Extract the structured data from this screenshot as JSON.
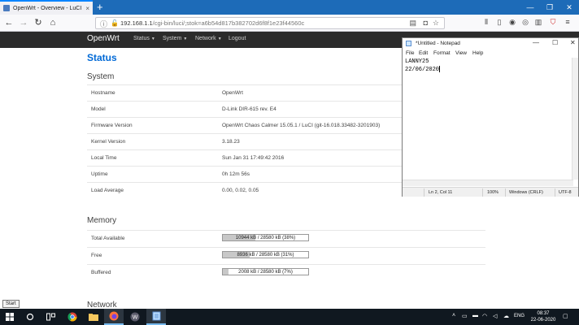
{
  "browser": {
    "tab_title": "OpenWrt - Overview - LuCI",
    "tab_close": "×",
    "new_tab": "+",
    "window_controls": [
      "—",
      "❐",
      "✕"
    ],
    "url_host": "192.168.1.1",
    "url_path": "/cgi-bin/luci/;stok=a6b54d817b382702d6f8f1e23f44560c",
    "icons": [
      "back-icon",
      "forward-icon",
      "reload-icon",
      "home-icon",
      "lock-warning-icon",
      "reader-icon",
      "pocket-icon",
      "star-icon",
      "library-icon",
      "sidebar-icon",
      "account-icon",
      "extension-icon",
      "menu-icon"
    ]
  },
  "header": {
    "brand": "OpenWrt",
    "menus": [
      "Status",
      "System",
      "Network",
      "Logout"
    ]
  },
  "page": {
    "title": "Status",
    "system": {
      "heading": "System",
      "rows": [
        {
          "label": "Hostname",
          "value": "OpenWrt"
        },
        {
          "label": "Model",
          "value": "D-Link DIR-615 rev. E4"
        },
        {
          "label": "Firmware Version",
          "value": "OpenWrt Chaos Calmer 15.05.1 / LuCI (git-16.018.33482-3201903)"
        },
        {
          "label": "Kernel Version",
          "value": "3.18.23"
        },
        {
          "label": "Local Time",
          "value": "Sun Jan 31 17:49:42 2016"
        },
        {
          "label": "Uptime",
          "value": "0h 12m 56s"
        },
        {
          "label": "Load Average",
          "value": "0.00, 0.02, 0.05"
        }
      ]
    },
    "memory": {
      "heading": "Memory",
      "rows": [
        {
          "label": "Total Available",
          "text": "10944 kB / 28580 kB (38%)",
          "percent": 38
        },
        {
          "label": "Free",
          "text": "8936 kB / 28580 kB (31%)",
          "percent": 31
        },
        {
          "label": "Buffered",
          "text": "2008 kB / 28580 kB (7%)",
          "percent": 7
        }
      ]
    },
    "network": {
      "heading": "Network"
    }
  },
  "notepad": {
    "title": "*Untitled - Notepad",
    "menu": [
      "File",
      "Edit",
      "Format",
      "View",
      "Help"
    ],
    "lines": [
      "LANNY25",
      "22/06/2020"
    ],
    "status": {
      "position": "Ln 2, Col 11",
      "zoom": "100%",
      "line_ending": "Windows (CRLF)",
      "encoding": "UTF-8"
    }
  },
  "tooltip": "Start",
  "taskbar": {
    "language": "ENG",
    "time": "08:37",
    "date": "22-06-2020"
  }
}
